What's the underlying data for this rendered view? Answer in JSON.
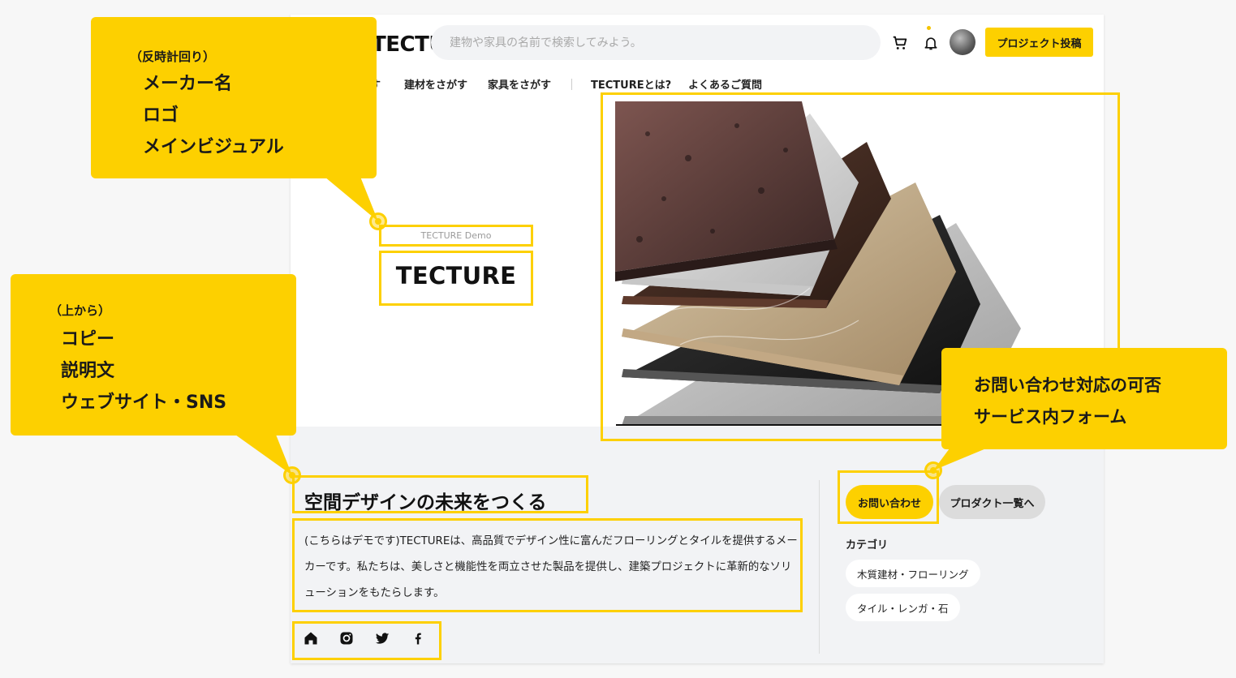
{
  "header": {
    "logo": "TECTURE",
    "search_placeholder": "建物や家具の名前で検索してみよう。",
    "post_button": "プロジェクト投稿"
  },
  "nav": {
    "items": [
      "す",
      "建材をさがす",
      "家具をさがす",
      "TECTUREとは?",
      "よくあるご質問"
    ]
  },
  "hero": {
    "brand_small": "TECTURE Demo",
    "brand_logo": "TECTURE"
  },
  "profile": {
    "copy": "空間デザインの未来をつくる",
    "description": "(こちらはデモです)TECTUREは、高品質でデザイン性に富んだフローリングとタイルを提供するメーカーです。私たちは、美しさと機能性を両立させた製品を提供し、建築プロジェクトに革新的なソリューションをもたらします。",
    "social_icons": [
      "home-icon",
      "instagram-icon",
      "twitter-icon",
      "facebook-icon"
    ]
  },
  "sidebar": {
    "contact_button": "お問い合わせ",
    "products_button": "プロダクト一覧へ",
    "category_heading": "カテゴリ",
    "categories": [
      "木質建材・フローリング",
      "タイル・レンガ・石"
    ]
  },
  "annotations": {
    "top_left": {
      "line1": "（反時計回り）",
      "line2": "メーカー名",
      "line3": "ロゴ",
      "line4": "メインビジュアル"
    },
    "mid_left": {
      "line1": "（上から）",
      "line2": "コピー",
      "line3": "説明文",
      "line4": "ウェブサイト・SNS"
    },
    "right": {
      "line1": "お問い合わせ対応の可否",
      "line2": "サービス内フォーム"
    },
    "accent_color": "#fdd000"
  }
}
